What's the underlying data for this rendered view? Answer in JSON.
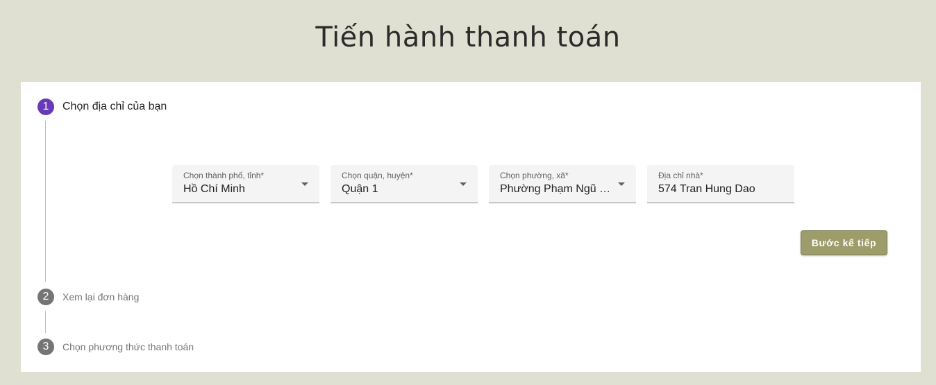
{
  "page": {
    "title": "Tiến hành thanh toán"
  },
  "steps": [
    {
      "number": "1",
      "label": "Chọn địa chỉ của bạn",
      "state": "active"
    },
    {
      "number": "2",
      "label": "Xem lại đơn hàng",
      "state": "inactive"
    },
    {
      "number": "3",
      "label": "Chọn phương thức thanh toán",
      "state": "inactive"
    }
  ],
  "address_form": {
    "city": {
      "label": "Chọn thành phố, tỉnh*",
      "value": "Hồ Chí Minh",
      "icon": "dropdown-arrow-icon"
    },
    "district": {
      "label": "Chọn quận, huyện*",
      "value": "Quận 1",
      "icon": "dropdown-arrow-icon"
    },
    "ward": {
      "label": "Chọn phường, xã*",
      "value": "Phường Phạm Ngũ L…",
      "icon": "dropdown-arrow-icon"
    },
    "street": {
      "label": "Địa chỉ nhà*",
      "value": "574 Tran Hung Dao"
    },
    "next_label": "Bước kế tiếp"
  },
  "colors": {
    "background": "#e0e0d2",
    "active_step": "#673ab7",
    "inactive_step": "#757575",
    "button": "#9c9d6b"
  }
}
